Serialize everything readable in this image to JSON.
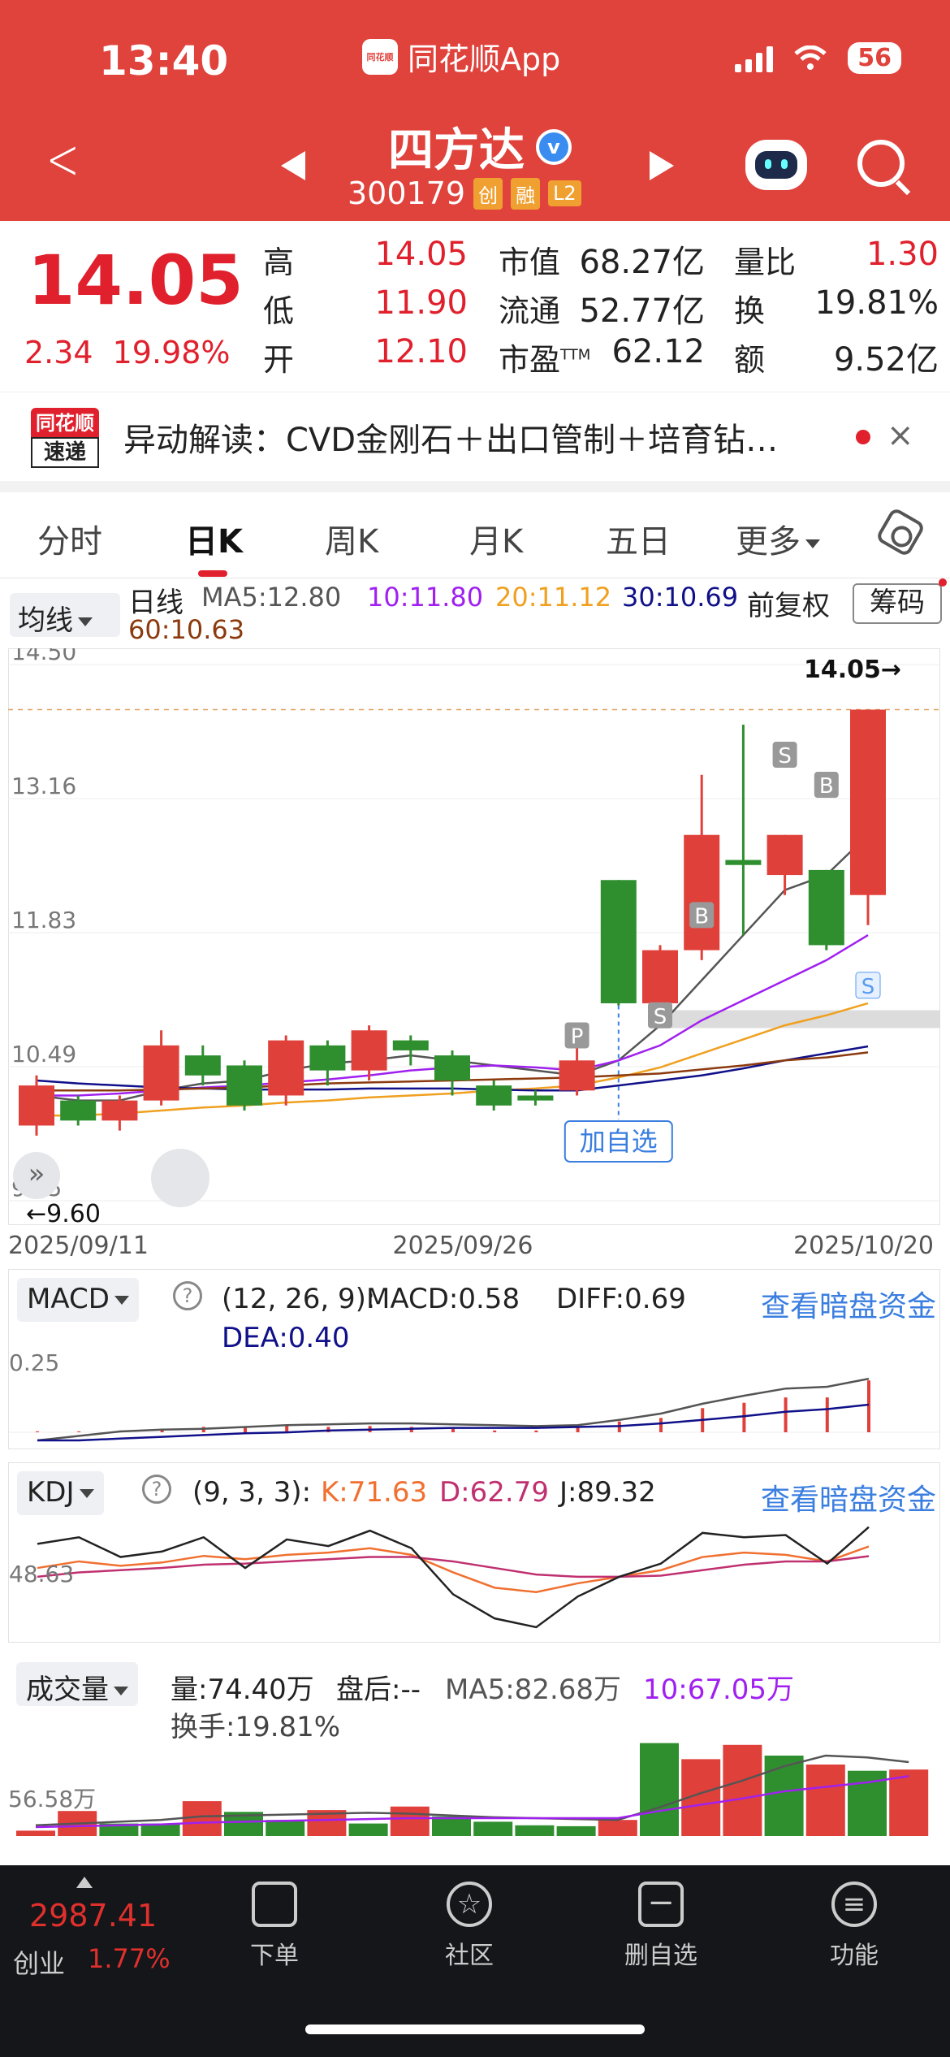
{
  "status": {
    "time": "13:40",
    "app_name": "同花顺App",
    "battery": "56"
  },
  "header": {
    "back_label": "<",
    "stock_name": "四方达",
    "verified_mark": "v",
    "stock_code": "300179",
    "tags": [
      "创",
      "融",
      "L2"
    ],
    "logo_text": "同花顺"
  },
  "quote": {
    "price": "14.05",
    "change": "2.34",
    "change_pct": "19.98%",
    "rows": [
      {
        "label1": "高",
        "val1": "14.05",
        "label2": "市值",
        "val2": "68.27亿",
        "label3": "量比",
        "val3": "1.30"
      },
      {
        "label1": "低",
        "val1": "11.90",
        "label2": "流通",
        "val2": "52.77亿",
        "label3": "换",
        "val3": "19.81%"
      },
      {
        "label1": "开",
        "val1": "12.10",
        "label2": "市盈",
        "label2_sup": "TTM",
        "val2": "62.12",
        "label3": "额",
        "val3": "9.52亿"
      }
    ]
  },
  "news": {
    "badge_top": "同花顺",
    "badge_bottom": "速递",
    "text": "异动解读：CVD金刚石＋出口管制＋培育钻…",
    "close": "×"
  },
  "tabs": [
    "分时",
    "日K",
    "周K",
    "月K",
    "五日",
    "更多"
  ],
  "active_tab": "日K",
  "ma_legend": {
    "selector": "均线",
    "period": "日线",
    "ma5": "MA5:12.80",
    "ma10": "10:11.80",
    "ma20": "20:11.12",
    "ma30": "30:10.69",
    "ma60": "60:10.63",
    "adjust": "前复权",
    "chips": "筹码"
  },
  "colors": {
    "up": "#e0403a",
    "down": "#2f8f2f",
    "ma5": "#555555",
    "ma10": "#a020f0",
    "ma20": "#f0a020",
    "ma30": "#10108a",
    "ma60": "#8b3a0e",
    "accent": "#e0423c",
    "link": "#3a7ee0"
  },
  "chart_data": [
    {
      "type": "candlestick",
      "title": "日K",
      "y_ticks": [
        "14.50",
        "13.16",
        "11.83",
        "10.49",
        "9.15"
      ],
      "ylim": [
        9.15,
        14.5
      ],
      "x_labels": [
        "2025/09/11",
        "2025/09/26",
        "2025/10/20"
      ],
      "high_label": "14.05→",
      "low_label": "←9.60",
      "add_watch_label": "加自选",
      "markers": [
        "P",
        "S",
        "B",
        "S",
        "B",
        "S"
      ],
      "candles": [
        {
          "o": 9.9,
          "c": 10.3,
          "h": 10.4,
          "l": 9.8
        },
        {
          "o": 10.15,
          "c": 9.95,
          "h": 10.2,
          "l": 9.9
        },
        {
          "o": 9.95,
          "c": 10.15,
          "h": 10.2,
          "l": 9.85
        },
        {
          "o": 10.15,
          "c": 10.7,
          "h": 10.85,
          "l": 10.1
        },
        {
          "o": 10.6,
          "c": 10.4,
          "h": 10.7,
          "l": 10.3
        },
        {
          "o": 10.5,
          "c": 10.1,
          "h": 10.55,
          "l": 10.05
        },
        {
          "o": 10.2,
          "c": 10.75,
          "h": 10.8,
          "l": 10.1
        },
        {
          "o": 10.7,
          "c": 10.45,
          "h": 10.75,
          "l": 10.3
        },
        {
          "o": 10.45,
          "c": 10.85,
          "h": 10.9,
          "l": 10.35
        },
        {
          "o": 10.75,
          "c": 10.65,
          "h": 10.8,
          "l": 10.5
        },
        {
          "o": 10.6,
          "c": 10.35,
          "h": 10.65,
          "l": 10.2
        },
        {
          "o": 10.3,
          "c": 10.1,
          "h": 10.35,
          "l": 10.05
        },
        {
          "o": 10.2,
          "c": 10.15,
          "h": 10.25,
          "l": 10.1
        },
        {
          "o": 10.25,
          "c": 10.55,
          "h": 10.7,
          "l": 10.2
        },
        {
          "o": 12.35,
          "c": 11.12,
          "h": 12.35,
          "l": 11.1
        },
        {
          "o": 11.12,
          "c": 11.65,
          "h": 11.7,
          "l": 11.0
        },
        {
          "o": 11.65,
          "c": 12.8,
          "h": 13.4,
          "l": 11.55
        },
        {
          "o": 12.55,
          "c": 12.5,
          "h": 13.9,
          "l": 11.8
        },
        {
          "o": 12.4,
          "c": 12.8,
          "h": 12.8,
          "l": 12.2
        },
        {
          "o": 12.45,
          "c": 11.7,
          "h": 12.45,
          "l": 11.65
        },
        {
          "o": 12.2,
          "c": 14.05,
          "h": 14.05,
          "l": 11.9
        }
      ],
      "series": [
        {
          "name": "MA5",
          "values": [
            10.2,
            10.15,
            10.15,
            10.25,
            10.32,
            10.35,
            10.45,
            10.52,
            10.55,
            10.6,
            10.55,
            10.5,
            10.45,
            10.4,
            10.55,
            10.9,
            11.35,
            11.8,
            12.25,
            12.4,
            12.8
          ]
        },
        {
          "name": "10",
          "values": [
            10.2,
            10.2,
            10.22,
            10.25,
            10.28,
            10.3,
            10.33,
            10.36,
            10.4,
            10.45,
            10.48,
            10.5,
            10.48,
            10.45,
            10.55,
            10.7,
            10.95,
            11.15,
            11.35,
            11.55,
            11.8
          ]
        },
        {
          "name": "20",
          "values": [
            10.0,
            10.0,
            10.02,
            10.05,
            10.08,
            10.1,
            10.13,
            10.15,
            10.18,
            10.2,
            10.22,
            10.25,
            10.27,
            10.3,
            10.38,
            10.48,
            10.62,
            10.76,
            10.9,
            11.0,
            11.12
          ]
        },
        {
          "name": "30",
          "values": [
            10.35,
            10.32,
            10.3,
            10.28,
            10.27,
            10.26,
            10.26,
            10.26,
            10.27,
            10.27,
            10.27,
            10.26,
            10.25,
            10.25,
            10.3,
            10.35,
            10.4,
            10.47,
            10.55,
            10.62,
            10.69
          ]
        },
        {
          "name": "60",
          "values": [
            10.25,
            10.25,
            10.25,
            10.26,
            10.27,
            10.28,
            10.3,
            10.32,
            10.33,
            10.34,
            10.35,
            10.36,
            10.37,
            10.38,
            10.4,
            10.42,
            10.46,
            10.5,
            10.55,
            10.58,
            10.63
          ]
        }
      ]
    },
    {
      "type": "bar",
      "title": "MACD",
      "params": "(12, 26, 9):",
      "macd_label": "MACD:0.58",
      "diff_label": "DIFF:0.69",
      "dea_label": "DEA:0.40",
      "y_tick": "0.25",
      "link": "查看暗盘资金",
      "selector": "MACD",
      "values": [
        0.01,
        0.01,
        0.02,
        0.04,
        0.06,
        0.05,
        0.07,
        0.06,
        0.07,
        0.06,
        0.04,
        0.02,
        0.02,
        0.06,
        0.12,
        0.16,
        0.27,
        0.33,
        0.39,
        0.39,
        0.58
      ],
      "series": [
        {
          "name": "DIFF",
          "values": [
            0.0,
            0.05,
            0.1,
            0.12,
            0.13,
            0.15,
            0.17,
            0.18,
            0.19,
            0.19,
            0.18,
            0.17,
            0.16,
            0.17,
            0.23,
            0.3,
            0.41,
            0.5,
            0.58,
            0.6,
            0.69
          ]
        },
        {
          "name": "DEA",
          "values": [
            0.0,
            0.0,
            0.02,
            0.04,
            0.06,
            0.08,
            0.09,
            0.11,
            0.12,
            0.13,
            0.14,
            0.14,
            0.14,
            0.15,
            0.16,
            0.19,
            0.23,
            0.27,
            0.32,
            0.35,
            0.4
          ]
        }
      ]
    },
    {
      "type": "line",
      "title": "KDJ",
      "params": "(9, 3, 3):",
      "k_label": "K:71.63",
      "d_label": "D:62.79",
      "j_label": "J:89.32",
      "y_tick": "48.63",
      "link": "查看暗盘资金",
      "selector": "KDJ",
      "series": [
        {
          "name": "K",
          "values": [
            52,
            58,
            54,
            57,
            63,
            60,
            64,
            66,
            70,
            64,
            48,
            34,
            30,
            38,
            44,
            50,
            62,
            66,
            64,
            58,
            71.63
          ]
        },
        {
          "name": "D",
          "values": [
            44,
            48,
            50,
            52,
            55,
            56,
            58,
            60,
            62,
            62,
            58,
            52,
            46,
            44,
            44,
            45,
            50,
            55,
            58,
            58,
            62.79
          ]
        },
        {
          "name": "J",
          "values": [
            74,
            80,
            62,
            67,
            80,
            52,
            78,
            72,
            86,
            70,
            28,
            6,
            -2,
            26,
            44,
            56,
            84,
            80,
            82,
            56,
            89.32
          ]
        }
      ]
    },
    {
      "type": "bar",
      "title": "成交量",
      "volume_label": "量:74.40万",
      "after_hours_label": "盘后:--",
      "ma5_label": "MA5:82.68万",
      "ma10_label": "10:67.05万",
      "turnover_label": "换手:19.81%",
      "y_tick": "56.58万",
      "selector": "成交量",
      "values": [
        6,
        28,
        14,
        14,
        39,
        27,
        18,
        29,
        14,
        33,
        22,
        16,
        12,
        11,
        18,
        104,
        86,
        102,
        90,
        80,
        73,
        74.4
      ],
      "directions": [
        "up",
        "up",
        "down",
        "down",
        "up",
        "down",
        "down",
        "up",
        "down",
        "up",
        "down",
        "down",
        "down",
        "down",
        "up",
        "down",
        "up",
        "up",
        "down",
        "up",
        "down",
        "up"
      ],
      "series": [
        {
          "name": "MA5",
          "values": [
            12,
            14,
            16,
            18,
            22,
            23,
            24,
            25,
            26,
            25,
            23,
            21,
            20,
            19,
            18,
            32,
            48,
            62,
            78,
            90,
            88,
            82.68
          ]
        },
        {
          "name": "10",
          "values": [
            10,
            11,
            12,
            13,
            15,
            16,
            17,
            18,
            19,
            20,
            20,
            20,
            20,
            20,
            20,
            28,
            35,
            42,
            50,
            55,
            60,
            67.05
          ]
        }
      ]
    }
  ],
  "bottom_bar": {
    "index_value": "2987.41",
    "index_name": "创业",
    "index_pct": "1.77%",
    "items": [
      "下单",
      "社区",
      "删自选",
      "功能"
    ]
  }
}
